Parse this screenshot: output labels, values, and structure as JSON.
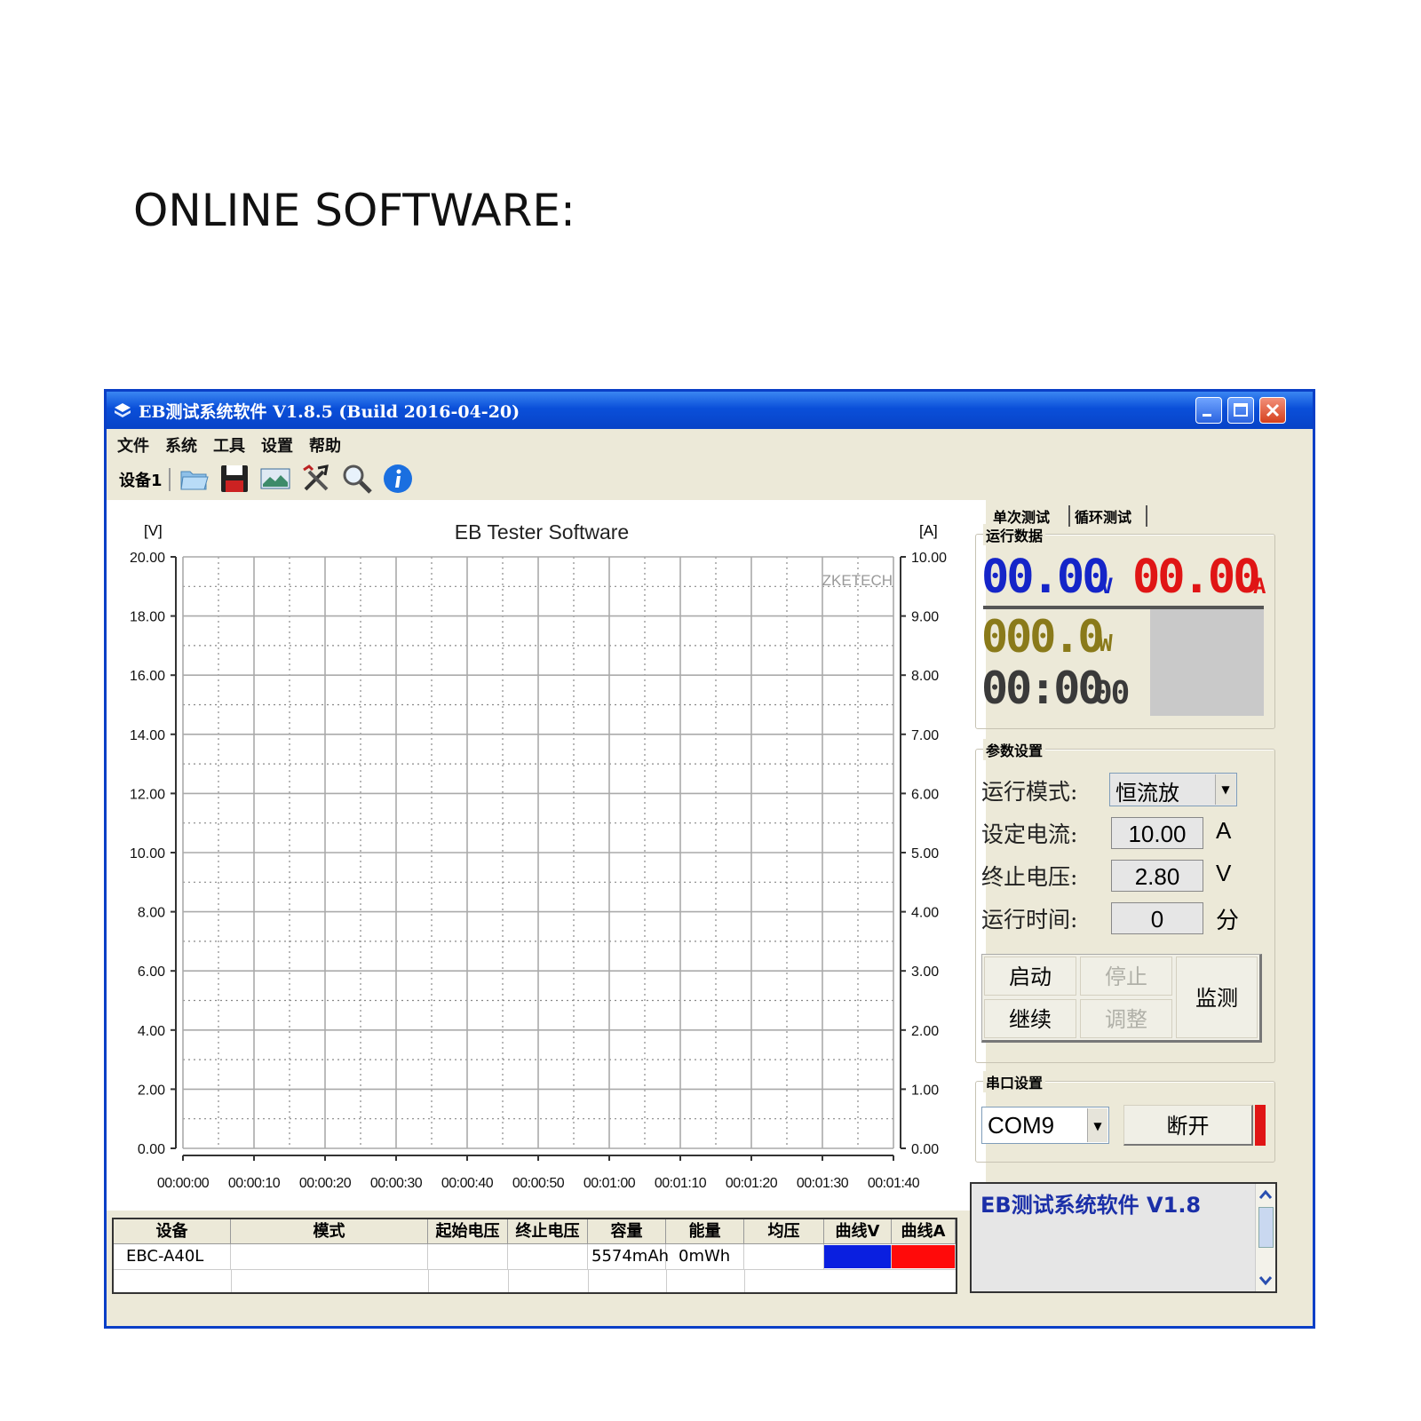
{
  "page_heading": "ONLINE SOFTWARE:",
  "window": {
    "title": "EB测试系统软件 V1.8.5 (Build 2016-04-20)"
  },
  "menu": [
    "文件",
    "系统",
    "工具",
    "设置",
    "帮助"
  ],
  "toolbar": {
    "device_label": "设备1",
    "icons": [
      "folder-icon",
      "save-icon",
      "picture-icon",
      "tools-icon",
      "search-icon",
      "info-icon"
    ]
  },
  "chart_data": {
    "type": "line",
    "title": "EB Tester Software",
    "watermark": "ZKETECH",
    "ylabel_left": "[V]",
    "ylabel_right": "[A]",
    "ylim_left": [
      0,
      20
    ],
    "ylim_right": [
      0,
      10
    ],
    "yticks_left": [
      "0.00",
      "2.00",
      "4.00",
      "6.00",
      "8.00",
      "10.00",
      "12.00",
      "14.00",
      "16.00",
      "18.00",
      "20.00"
    ],
    "yticks_right": [
      "0.00",
      "1.00",
      "2.00",
      "3.00",
      "4.00",
      "5.00",
      "6.00",
      "7.00",
      "8.00",
      "9.00",
      "10.00"
    ],
    "xticks": [
      "00:00:00",
      "00:00:10",
      "00:00:20",
      "00:00:30",
      "00:00:40",
      "00:00:50",
      "00:01:00",
      "00:01:10",
      "00:01:20",
      "00:01:30",
      "00:01:40"
    ],
    "grid": true,
    "series": []
  },
  "right_panel": {
    "tabs": [
      "单次测试",
      "循环测试"
    ],
    "run_group_label": "运行数据",
    "voltage": "00.00",
    "voltage_unit": "V",
    "current": "00.00",
    "current_unit": "A",
    "power": "000.0",
    "power_unit": "W",
    "time_main": "00:00",
    "time_sec": "00",
    "param_group_label": "参数设置",
    "params": [
      {
        "label": "运行模式:",
        "value": "恒流放",
        "unit": ""
      },
      {
        "label": "设定电流:",
        "value": "10.00",
        "unit": "A"
      },
      {
        "label": "终止电压:",
        "value": "2.80",
        "unit": "V"
      },
      {
        "label": "运行时间:",
        "value": "0",
        "unit": "分"
      }
    ],
    "buttons": {
      "start": "启动",
      "stop": "停止",
      "continue": "继续",
      "adjust": "调整",
      "monitor": "监测"
    },
    "serial_group_label": "串口设置",
    "com_port": "COM9",
    "disconnect": "断开",
    "log_text": "EB测试系统软件 V1.8"
  },
  "table": {
    "headers": [
      "设备",
      "模式",
      "起始电压",
      "终止电压",
      "容量",
      "能量",
      "均压",
      "曲线V",
      "曲线A"
    ],
    "rows": [
      {
        "device": "EBC-A40L",
        "mode": "",
        "start_v": "",
        "end_v": "",
        "capacity": "5574mAh",
        "energy": "0mWh",
        "avg_v": "",
        "curve_v_color": "#0a1fe0",
        "curve_a_color": "#ff0a0a"
      }
    ]
  },
  "colors": {
    "voltage": "#1525c8",
    "current": "#e01515",
    "power": "#8a7a1a",
    "time": "#333333",
    "status": "#e01515"
  }
}
